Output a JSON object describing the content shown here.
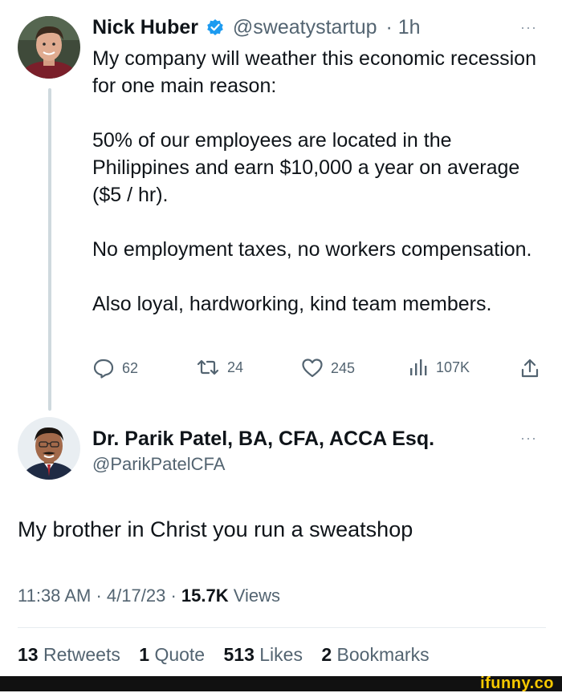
{
  "tweet": {
    "author_name": "Nick Huber",
    "handle": "@sweatystartup",
    "time": "· 1h",
    "more": "···",
    "paragraphs": [
      "My company will weather this economic recession for one main reason:",
      "50% of our employees are located in the Philippines and earn $10,000 a year on average ($5 / hr).",
      "No employment taxes, no workers compensation.",
      "Also loyal, hardworking, kind team members."
    ],
    "actions": {
      "replies": "62",
      "retweets": "24",
      "likes": "245",
      "views": "107K"
    },
    "colors": {
      "verified": "#1d9bf0",
      "muted": "#536471"
    }
  },
  "reply": {
    "author_name": "Dr. Parik Patel, BA, CFA, ACCA Esq.",
    "handle": "@ParikPatelCFA",
    "more": "···",
    "text": "My brother in Christ you run a sweatshop",
    "time": "11:38 AM",
    "date": "4/17/23",
    "views_count": "15.7K",
    "views_label": "Views",
    "stats": {
      "retweets_count": "13",
      "retweets_label": "Retweets",
      "quotes_count": "1",
      "quotes_label": "Quote",
      "likes_count": "513",
      "likes_label": "Likes",
      "bookmarks_count": "2",
      "bookmarks_label": "Bookmarks"
    }
  },
  "watermark": {
    "text": "ifunny.co",
    "color": "#f7c800"
  }
}
